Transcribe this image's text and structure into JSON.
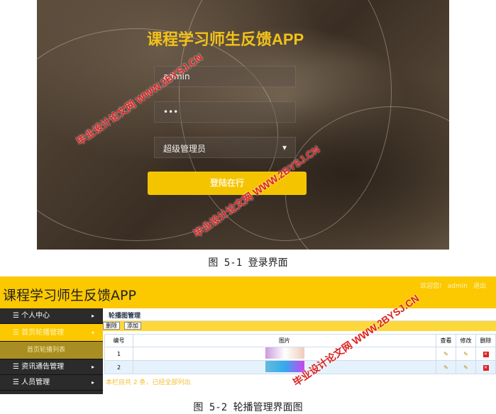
{
  "login": {
    "title": "课程学习师生反馈APP",
    "username": "admin",
    "password": "•••",
    "role": "超级管理员",
    "submit": "登陆在行"
  },
  "caption1": "图 5-1 登录界面",
  "admin": {
    "title": "课程学习师生反馈APP",
    "welcome": "欢迎您!",
    "user": "admin",
    "logout": "退出",
    "sidebar": [
      {
        "label": "个人中心"
      },
      {
        "label": "首页轮播管理"
      },
      {
        "label": "首页轮播列表"
      },
      {
        "label": "资讯通告管理"
      },
      {
        "label": "人员管理"
      }
    ],
    "breadcrumb": "轮播图管理",
    "toolbar": {
      "delete": "删除",
      "add": "添加"
    },
    "table": {
      "headers": [
        "编号",
        "图片",
        "查看",
        "修改",
        "删除"
      ],
      "rows": [
        {
          "id": "1"
        },
        {
          "id": "2"
        }
      ]
    },
    "footer": "本栏目共 2 条，已经全部列出"
  },
  "caption2": "图 5-2 轮播管理界面图",
  "watermark": {
    "line1": "毕业设计论文网",
    "line2": "WWW.2BYSJ.CN"
  }
}
